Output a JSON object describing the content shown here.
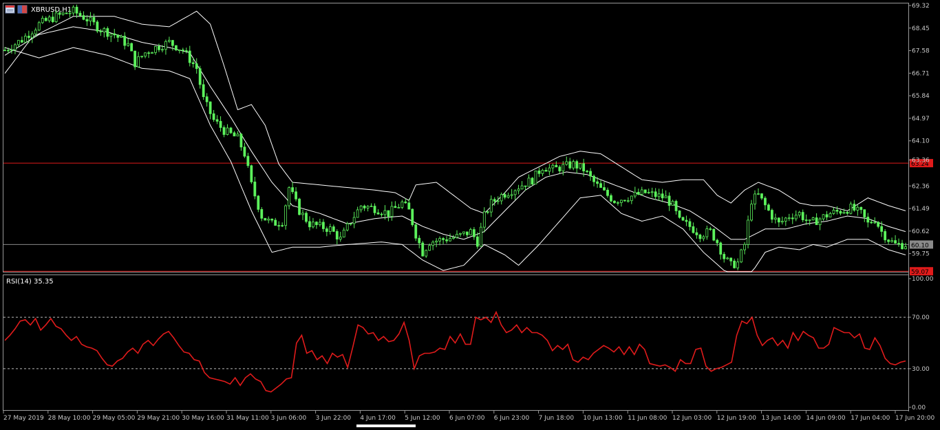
{
  "window": {
    "title": "XBRUSD,H1",
    "icons": [
      "chart-window-icon",
      "chart-window-icon"
    ]
  },
  "main_chart": {
    "symbol_label": "XBRUSD,H1",
    "price_ticks": [
      "69.32",
      "68.45",
      "67.58",
      "66.71",
      "65.84",
      "64.97",
      "64.10",
      "63.36",
      "62.36",
      "61.49",
      "60.62",
      "59.75"
    ],
    "price_range": [
      59.05,
      69.4
    ],
    "hlines": [
      {
        "price": 63.24,
        "color": "#e01b1b",
        "label": "63.24"
      },
      {
        "price": 60.1,
        "color": "#8a8a8a",
        "label": "60.10"
      },
      {
        "price": 59.07,
        "color": "#e01b1b",
        "label": "59.07"
      }
    ],
    "candle_color": "#5cf25c",
    "band_color": "#ffffff"
  },
  "rsi_panel": {
    "label": "RSI(14) 35.35",
    "ticks": [
      "100.00",
      "70.00",
      "30.00",
      "0.00"
    ],
    "levels": [
      70,
      30
    ],
    "line_color": "#e01b1b"
  },
  "time_axis": {
    "labels": [
      "27 May 2019",
      "28 May 10:00",
      "29 May 05:00",
      "29 May 21:00",
      "30 May 16:00",
      "31 May 11:00",
      "3 Jun 06:00",
      "3 Jun 22:00",
      "4 Jun 17:00",
      "5 Jun 12:00",
      "6 Jun 07:00",
      "6 Jun 23:00",
      "7 Jun 18:00",
      "10 Jun 13:00",
      "11 Jun 08:00",
      "12 Jun 03:00",
      "12 Jun 19:00",
      "13 Jun 14:00",
      "14 Jun 09:00",
      "17 Jun 04:00",
      "17 Jun 20:00"
    ]
  },
  "chart_data": [
    {
      "type": "candlestick",
      "title": "XBRUSD,H1",
      "ylim": [
        59.05,
        69.4
      ],
      "x": [
        "27 May 2019",
        "28 May 10:00",
        "29 May 05:00",
        "29 May 21:00",
        "30 May 16:00",
        "31 May 11:00",
        "3 Jun 06:00",
        "3 Jun 22:00",
        "4 Jun 17:00",
        "5 Jun 12:00",
        "6 Jun 07:00",
        "6 Jun 23:00",
        "7 Jun 18:00",
        "10 Jun 13:00",
        "11 Jun 08:00",
        "12 Jun 03:00",
        "12 Jun 19:00",
        "13 Jun 14:00",
        "14 Jun 09:00",
        "17 Jun 04:00",
        "17 Jun 20:00"
      ],
      "close_path": [
        [
          0,
          67.6
        ],
        [
          5,
          68.0
        ],
        [
          10,
          68.6
        ],
        [
          15,
          68.9
        ],
        [
          20,
          69.1
        ],
        [
          24,
          68.8
        ],
        [
          28,
          68.4
        ],
        [
          32,
          68.2
        ],
        [
          36,
          67.8
        ],
        [
          38,
          67.1
        ],
        [
          41,
          67.5
        ],
        [
          44,
          67.7
        ],
        [
          48,
          67.9
        ],
        [
          52,
          67.6
        ],
        [
          56,
          66.9
        ],
        [
          58,
          65.7
        ],
        [
          61,
          64.9
        ],
        [
          64,
          64.5
        ],
        [
          68,
          64.2
        ],
        [
          70,
          63.6
        ],
        [
          72,
          62.4
        ],
        [
          75,
          61.2
        ],
        [
          78,
          60.9
        ],
        [
          81,
          61.0
        ],
        [
          83,
          62.3
        ],
        [
          86,
          61.4
        ],
        [
          89,
          60.9
        ],
        [
          92,
          60.8
        ],
        [
          95,
          60.7
        ],
        [
          98,
          60.3
        ],
        [
          101,
          61.0
        ],
        [
          104,
          61.6
        ],
        [
          108,
          61.5
        ],
        [
          112,
          61.3
        ],
        [
          116,
          61.7
        ],
        [
          118,
          61.4
        ],
        [
          120,
          60.5
        ],
        [
          122,
          59.8
        ],
        [
          124,
          60.2
        ],
        [
          128,
          60.3
        ],
        [
          132,
          60.4
        ],
        [
          136,
          60.6
        ],
        [
          138,
          60.2
        ],
        [
          140,
          61.2
        ],
        [
          142,
          61.7
        ],
        [
          145,
          62.0
        ],
        [
          148,
          62.2
        ],
        [
          151,
          62.4
        ],
        [
          154,
          62.6
        ],
        [
          157,
          63.1
        ],
        [
          160,
          63.0
        ],
        [
          163,
          63.1
        ],
        [
          166,
          63.2
        ],
        [
          169,
          63.0
        ],
        [
          172,
          62.5
        ],
        [
          175,
          62.1
        ],
        [
          178,
          61.8
        ],
        [
          181,
          61.9
        ],
        [
          184,
          62.0
        ],
        [
          187,
          62.1
        ],
        [
          190,
          62.0
        ],
        [
          193,
          61.9
        ],
        [
          195,
          61.6
        ],
        [
          197,
          61.0
        ],
        [
          200,
          60.8
        ],
        [
          203,
          60.5
        ],
        [
          206,
          60.6
        ],
        [
          208,
          60.2
        ],
        [
          210,
          59.6
        ],
        [
          212,
          59.3
        ],
        [
          214,
          59.4
        ],
        [
          216,
          60.1
        ],
        [
          218,
          61.8
        ],
        [
          220,
          62.0
        ],
        [
          222,
          61.6
        ],
        [
          224,
          61.2
        ],
        [
          226,
          60.9
        ],
        [
          229,
          61.2
        ],
        [
          232,
          61.3
        ],
        [
          235,
          60.9
        ],
        [
          238,
          61.1
        ],
        [
          241,
          61.3
        ],
        [
          244,
          61.4
        ],
        [
          247,
          61.5
        ],
        [
          250,
          61.3
        ],
        [
          252,
          60.9
        ],
        [
          254,
          61.1
        ],
        [
          256,
          60.6
        ],
        [
          258,
          60.3
        ],
        [
          260,
          60.1
        ],
        [
          263,
          60.1
        ]
      ],
      "bollinger_upper": [
        [
          0,
          66.7
        ],
        [
          8,
          68.1
        ],
        [
          20,
          68.9
        ],
        [
          32,
          68.9
        ],
        [
          40,
          68.6
        ],
        [
          48,
          68.5
        ],
        [
          52,
          68.8
        ],
        [
          56,
          69.1
        ],
        [
          60,
          68.6
        ],
        [
          64,
          67.0
        ],
        [
          68,
          65.3
        ],
        [
          72,
          65.5
        ],
        [
          76,
          64.7
        ],
        [
          80,
          63.2
        ],
        [
          84,
          62.5
        ],
        [
          92,
          62.4
        ],
        [
          100,
          62.3
        ],
        [
          108,
          62.2
        ],
        [
          114,
          62.1
        ],
        [
          118,
          61.8
        ],
        [
          120,
          62.4
        ],
        [
          126,
          62.5
        ],
        [
          132,
          61.9
        ],
        [
          136,
          61.5
        ],
        [
          140,
          61.3
        ],
        [
          146,
          62.1
        ],
        [
          150,
          62.7
        ],
        [
          156,
          63.1
        ],
        [
          162,
          63.5
        ],
        [
          168,
          63.7
        ],
        [
          174,
          63.6
        ],
        [
          180,
          63.1
        ],
        [
          186,
          62.6
        ],
        [
          192,
          62.5
        ],
        [
          198,
          62.6
        ],
        [
          204,
          62.6
        ],
        [
          208,
          62.0
        ],
        [
          212,
          61.7
        ],
        [
          216,
          62.2
        ],
        [
          220,
          62.5
        ],
        [
          226,
          62.2
        ],
        [
          232,
          61.7
        ],
        [
          236,
          61.6
        ],
        [
          240,
          61.6
        ],
        [
          246,
          61.4
        ],
        [
          252,
          61.9
        ],
        [
          258,
          61.6
        ],
        [
          263,
          61.4
        ]
      ],
      "bollinger_middle": [
        [
          0,
          67.4
        ],
        [
          10,
          68.2
        ],
        [
          20,
          68.5
        ],
        [
          30,
          68.3
        ],
        [
          40,
          67.9
        ],
        [
          48,
          67.7
        ],
        [
          54,
          67.5
        ],
        [
          60,
          66.2
        ],
        [
          66,
          65.0
        ],
        [
          72,
          63.7
        ],
        [
          78,
          62.5
        ],
        [
          84,
          61.6
        ],
        [
          92,
          61.3
        ],
        [
          100,
          60.9
        ],
        [
          108,
          61.1
        ],
        [
          116,
          61.2
        ],
        [
          122,
          60.8
        ],
        [
          128,
          60.5
        ],
        [
          134,
          60.3
        ],
        [
          140,
          60.6
        ],
        [
          146,
          61.4
        ],
        [
          152,
          62.2
        ],
        [
          158,
          62.7
        ],
        [
          164,
          62.9
        ],
        [
          170,
          62.8
        ],
        [
          176,
          62.5
        ],
        [
          182,
          62.2
        ],
        [
          188,
          61.9
        ],
        [
          194,
          61.7
        ],
        [
          200,
          61.4
        ],
        [
          206,
          60.9
        ],
        [
          212,
          60.3
        ],
        [
          216,
          60.3
        ],
        [
          222,
          60.7
        ],
        [
          228,
          60.7
        ],
        [
          234,
          60.9
        ],
        [
          240,
          61.0
        ],
        [
          246,
          61.2
        ],
        [
          252,
          61.1
        ],
        [
          258,
          60.8
        ],
        [
          263,
          60.6
        ]
      ],
      "bollinger_lower": [
        [
          0,
          67.7
        ],
        [
          10,
          67.3
        ],
        [
          20,
          67.7
        ],
        [
          30,
          67.4
        ],
        [
          40,
          66.9
        ],
        [
          48,
          66.8
        ],
        [
          54,
          66.5
        ],
        [
          60,
          64.7
        ],
        [
          66,
          63.3
        ],
        [
          72,
          61.4
        ],
        [
          78,
          59.8
        ],
        [
          84,
          60.0
        ],
        [
          92,
          60.0
        ],
        [
          100,
          60.1
        ],
        [
          110,
          60.2
        ],
        [
          116,
          60.1
        ],
        [
          122,
          59.5
        ],
        [
          128,
          59.1
        ],
        [
          134,
          59.3
        ],
        [
          140,
          60.1
        ],
        [
          146,
          59.7
        ],
        [
          150,
          59.3
        ],
        [
          156,
          60.1
        ],
        [
          162,
          61.0
        ],
        [
          168,
          61.9
        ],
        [
          174,
          62.0
        ],
        [
          180,
          61.3
        ],
        [
          186,
          61.0
        ],
        [
          192,
          61.2
        ],
        [
          198,
          60.7
        ],
        [
          204,
          59.8
        ],
        [
          210,
          59.1
        ],
        [
          214,
          58.9
        ],
        [
          218,
          59.0
        ],
        [
          222,
          59.8
        ],
        [
          226,
          60.0
        ],
        [
          232,
          59.9
        ],
        [
          236,
          60.1
        ],
        [
          240,
          60.0
        ],
        [
          246,
          60.3
        ],
        [
          252,
          60.3
        ],
        [
          258,
          59.9
        ],
        [
          263,
          59.7
        ]
      ]
    },
    {
      "type": "line",
      "title": "RSI(14) 35.35",
      "ylim": [
        0,
        100
      ],
      "levels": [
        70,
        30
      ],
      "series": [
        {
          "name": "RSI(14)",
          "values": [
            52,
            56,
            61,
            67,
            68,
            64,
            69,
            60,
            64,
            69,
            63,
            61,
            56,
            52,
            55,
            49,
            47,
            46,
            44,
            38,
            33,
            32,
            36,
            38,
            43,
            46,
            42,
            49,
            52,
            48,
            53,
            57,
            59,
            54,
            48,
            43,
            42,
            37,
            36,
            27,
            23,
            22,
            21,
            20,
            18,
            23,
            17,
            23,
            26,
            22,
            20,
            13,
            12,
            15,
            18,
            22,
            23,
            50,
            56,
            42,
            44,
            37,
            40,
            34,
            42,
            39,
            41,
            31,
            47,
            64,
            62,
            57,
            58,
            52,
            55,
            51,
            52,
            57,
            66,
            52,
            30,
            40,
            42,
            42,
            43,
            46,
            45,
            55,
            50,
            57,
            49,
            49,
            70,
            68,
            70,
            66,
            74,
            64,
            58,
            60,
            64,
            58,
            62,
            58,
            58,
            56,
            52,
            44,
            48,
            45,
            49,
            37,
            35,
            39,
            37,
            42,
            45,
            48,
            46,
            43,
            47,
            41,
            47,
            41,
            49,
            45,
            34,
            33,
            32,
            33,
            31,
            28,
            37,
            34,
            34,
            45,
            46,
            32,
            28,
            30,
            31,
            33,
            35,
            56,
            67,
            65,
            70,
            56,
            48,
            52,
            54,
            48,
            52,
            46,
            58,
            52,
            59,
            56,
            54,
            46,
            46,
            49,
            62,
            60,
            58,
            58,
            54,
            57,
            46,
            45,
            54,
            48,
            38,
            34,
            33,
            35,
            36
          ]
        }
      ]
    }
  ]
}
